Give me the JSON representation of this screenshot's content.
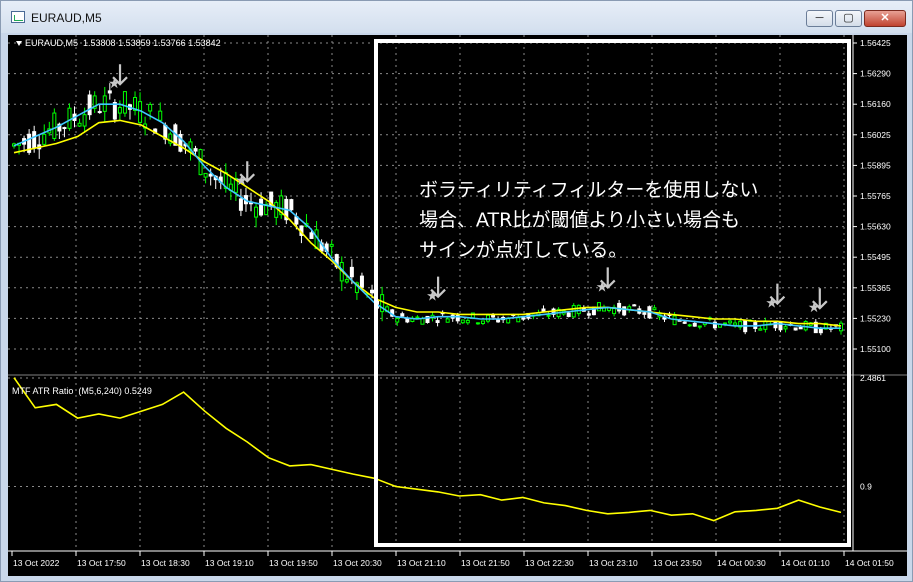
{
  "window": {
    "title": "EURAUD,M5",
    "min_label": "─",
    "max_label": "▢",
    "close_label": "✕"
  },
  "chart_header": {
    "symbol": "EURAUD,M5",
    "ohlc": "1.53808 1.53859 1.53766 1.53842"
  },
  "indicator_header": {
    "name": "MTF ATR Ratio",
    "params": "(M5,6,240)",
    "value": "0.5249"
  },
  "annotation": {
    "lines": [
      "ボラティリティフィルターを使用しない",
      "場合、ATR比が閾値より小さい場合も",
      "サインが点灯している。"
    ]
  },
  "colors": {
    "background": "#000000",
    "candle_up": "#00ff00",
    "candle_down": "#ffffff",
    "ma_fast": "#40c8ff",
    "ma_slow": "#ffff00",
    "atr_line": "#ffff00",
    "grid": "#8a8a8a",
    "signal_arrow": "#c8c8c8",
    "highlight_box": "#ffffff"
  },
  "chart_data": [
    {
      "type": "candlestick",
      "ylim": [
        1.551,
        1.56425
      ],
      "y_ticks": [
        "1.56425",
        "1.56290",
        "1.56160",
        "1.56025",
        "1.55895",
        "1.55765",
        "1.55630",
        "1.55495",
        "1.55365",
        "1.55230",
        "1.55100"
      ],
      "x_ticks": [
        "13 Oct 2022",
        "13 Oct 17:50",
        "13 Oct 18:30",
        "13 Oct 19:10",
        "13 Oct 19:50",
        "13 Oct 20:30",
        "13 Oct 21:10",
        "13 Oct 21:50",
        "13 Oct 22:30",
        "13 Oct 23:10",
        "13 Oct 23:50",
        "14 Oct 00:30",
        "14 Oct 01:10",
        "14 Oct 01:50"
      ],
      "ma_fast": [
        1.5598,
        1.5602,
        1.5606,
        1.5611,
        1.5616,
        1.5616,
        1.5613,
        1.5608,
        1.56,
        1.5589,
        1.558,
        1.5574,
        1.5572,
        1.557,
        1.5562,
        1.5549,
        1.5539,
        1.553,
        1.5524,
        1.5523,
        1.5524,
        1.5524,
        1.5523,
        1.5523,
        1.5524,
        1.5525,
        1.5526,
        1.5527,
        1.5528,
        1.5527,
        1.5526,
        1.5523,
        1.5522,
        1.5521,
        1.552,
        1.552,
        1.5521,
        1.552,
        1.5519,
        1.5519
      ],
      "ma_slow": [
        1.5595,
        1.5597,
        1.5599,
        1.5602,
        1.5608,
        1.5609,
        1.5607,
        1.5602,
        1.5597,
        1.5591,
        1.5586,
        1.558,
        1.5574,
        1.5566,
        1.5556,
        1.5548,
        1.5539,
        1.5532,
        1.5528,
        1.5526,
        1.5526,
        1.5525,
        1.5525,
        1.5525,
        1.5525,
        1.5526,
        1.5527,
        1.5528,
        1.5528,
        1.5527,
        1.5526,
        1.5525,
        1.5524,
        1.5523,
        1.5523,
        1.5522,
        1.5522,
        1.5521,
        1.5521,
        1.552
      ],
      "sell_signals_at": [
        5,
        11,
        20,
        28,
        36,
        38
      ]
    },
    {
      "type": "line",
      "name": "MTF ATR Ratio",
      "ylim": [
        0.0,
        2.4861
      ],
      "y_ticks": [
        "2.4861",
        "0.9"
      ],
      "values": [
        2.49,
        2.05,
        2.1,
        1.9,
        1.96,
        1.9,
        2.0,
        2.1,
        2.28,
        2.0,
        1.75,
        1.55,
        1.32,
        1.2,
        1.22,
        1.15,
        1.08,
        1.02,
        0.9,
        0.86,
        0.82,
        0.76,
        0.78,
        0.7,
        0.74,
        0.66,
        0.62,
        0.55,
        0.5,
        0.52,
        0.55,
        0.48,
        0.5,
        0.4,
        0.53,
        0.55,
        0.58,
        0.7,
        0.6,
        0.52
      ]
    }
  ]
}
